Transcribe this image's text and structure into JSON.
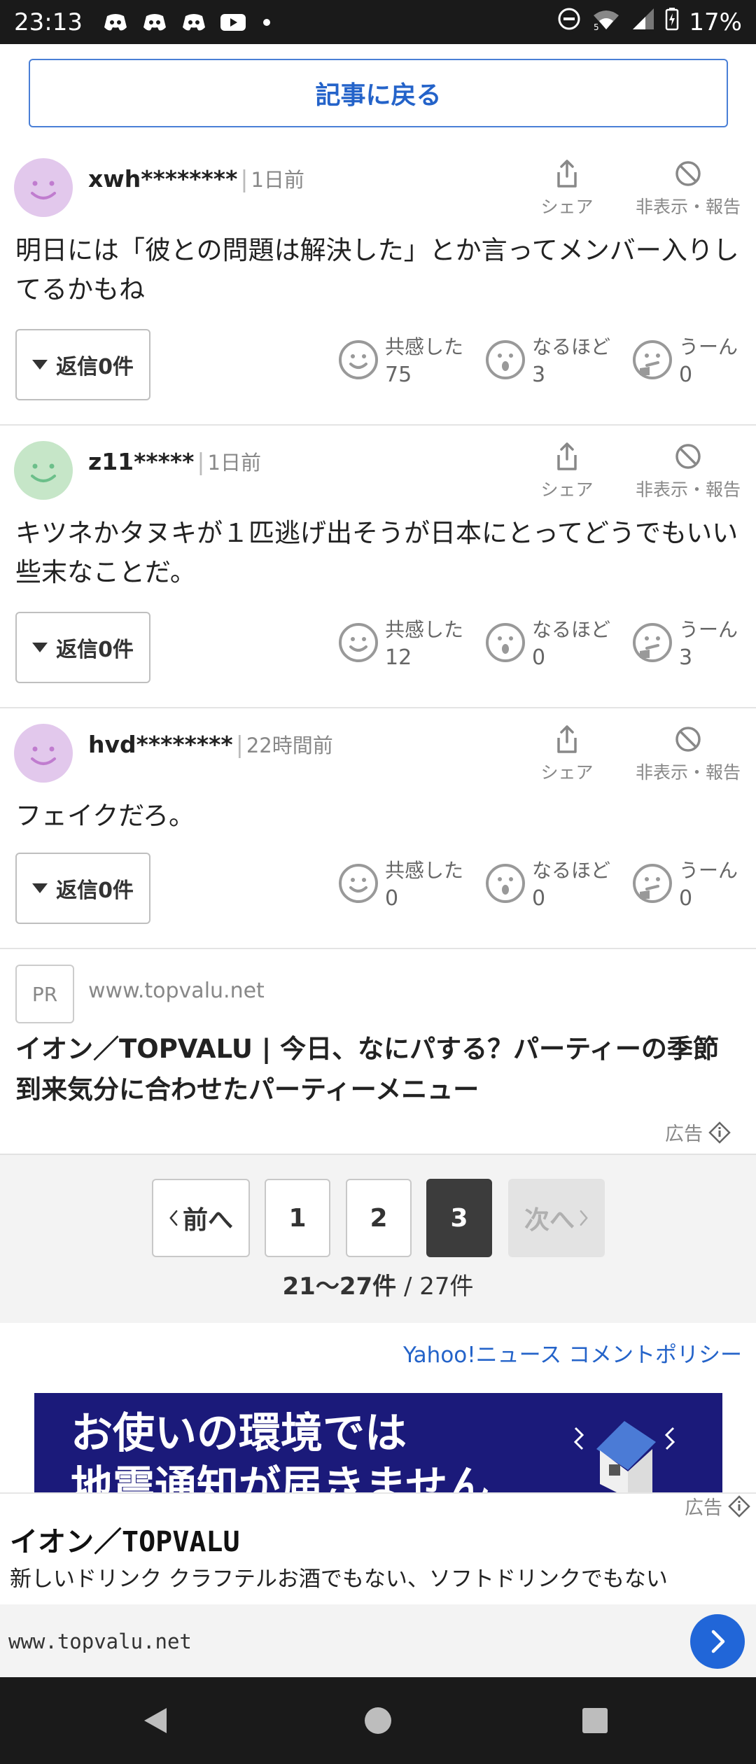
{
  "status_bar": {
    "time": "23:13",
    "battery": "17%",
    "network": "5"
  },
  "back_button": "記事に戻る",
  "comments": [
    {
      "username": "xwh********",
      "time_ago": "1日前",
      "avatar_color": "#e2c8ec",
      "avatar_face_color": "#c07ccf",
      "share_label": "シェア",
      "hide_label": "非表示・報告",
      "text": "明日には「彼との問題は解決した」とか言ってメンバー入りしてるかもね",
      "reply_label": "返信",
      "reply_count": "0件",
      "reactions": [
        {
          "label": "共感した",
          "count": "75"
        },
        {
          "label": "なるほど",
          "count": "3"
        },
        {
          "label": "うーん",
          "count": "0"
        }
      ]
    },
    {
      "username": "z11*****",
      "time_ago": "1日前",
      "avatar_color": "#c6e6c8",
      "avatar_face_color": "#6cbf8a",
      "share_label": "シェア",
      "hide_label": "非表示・報告",
      "text": "キツネかタヌキが１匹逃げ出そうが日本にとってどうでもいい些末なことだ。",
      "reply_label": "返信",
      "reply_count": "0件",
      "reactions": [
        {
          "label": "共感した",
          "count": "12"
        },
        {
          "label": "なるほど",
          "count": "0"
        },
        {
          "label": "うーん",
          "count": "3"
        }
      ]
    },
    {
      "username": "hvd********",
      "time_ago": "22時間前",
      "avatar_color": "#e2c8ec",
      "avatar_face_color": "#c07ccf",
      "share_label": "シェア",
      "hide_label": "非表示・報告",
      "text": "フェイクだろ。",
      "reply_label": "返信",
      "reply_count": "0件",
      "reactions": [
        {
          "label": "共感した",
          "count": "0"
        },
        {
          "label": "なるほど",
          "count": "0"
        },
        {
          "label": "うーん",
          "count": "0"
        }
      ]
    }
  ],
  "pr_ad": {
    "badge": "PR",
    "domain": "www.topvalu.net",
    "title": "イオン／TOPVALU | 今日、なにパする？パーティーの季節到来気分に合わせたパーティーメニュー",
    "ad_label": "広告"
  },
  "pagination": {
    "prev": "前へ",
    "pages": [
      "1",
      "2",
      "3"
    ],
    "current": "3",
    "next": "次へ",
    "range": "21〜27件",
    "total": " / 27件"
  },
  "policy_link": "Yahoo!ニュース コメントポリシー",
  "banner": {
    "line1": "お使いの環境では",
    "line2": "地震通知が届きません"
  },
  "bottom_ad": {
    "ad_label": "広告",
    "title": "イオン／TOPVALU",
    "description": "新しいドリンク クラフテルお酒でもない、ソフトドリンクでもない",
    "url": "www.topvalu.net"
  },
  "colors": {
    "accent": "#2463c9",
    "banner_bg": "#1b1a7a",
    "go_button": "#2166d8"
  }
}
